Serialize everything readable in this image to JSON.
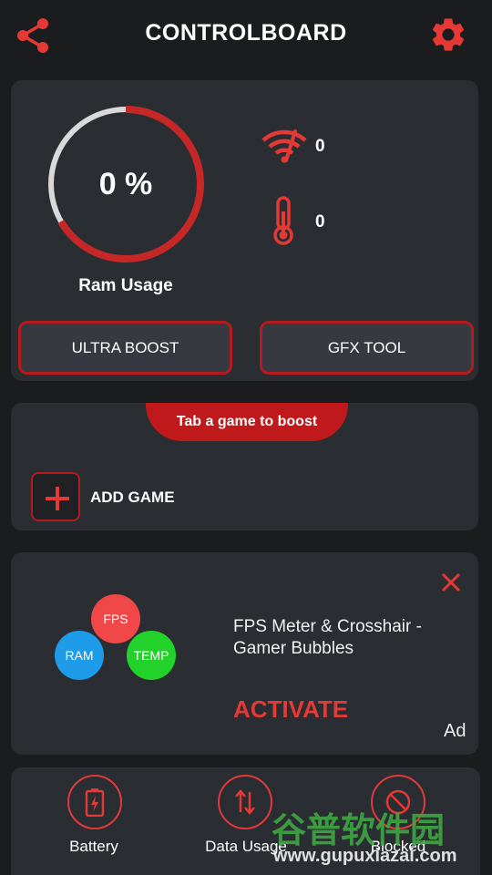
{
  "header": {
    "title": "CONTROLBOARD",
    "share_icon": "share-icon",
    "settings_icon": "gear-icon"
  },
  "stats": {
    "ram_percent_text": "0 %",
    "ram_fraction": 0.0,
    "ram_label": "Ram Usage",
    "ping_value": "0",
    "temp_value": "0",
    "ultra_boost_label": "ULTRA BOOST",
    "gfx_tool_label": "GFX TOOL"
  },
  "games": {
    "tab_label": "Tab a game to boost",
    "add_game_label": "ADD GAME"
  },
  "ad": {
    "bubble_fps": "FPS",
    "bubble_ram": "RAM",
    "bubble_temp": "TEMP",
    "title": "FPS Meter & Crosshair - Gamer Bubbles",
    "activate_label": "ACTIVATE",
    "ad_badge": "Ad"
  },
  "bottom_nav": {
    "battery_label": "Battery",
    "data_usage_label": "Data Usage",
    "blocked_label": "Blocked"
  },
  "watermark": {
    "cn_text": "谷普软件园",
    "url_text": "www.gupuxiazai.com"
  },
  "colors": {
    "accent": "#e53935",
    "background": "#1a1c1e",
    "card": "#2a2d31",
    "bubble_fps": "#f04848",
    "bubble_ram": "#1e9be9",
    "bubble_temp": "#22d22a"
  }
}
